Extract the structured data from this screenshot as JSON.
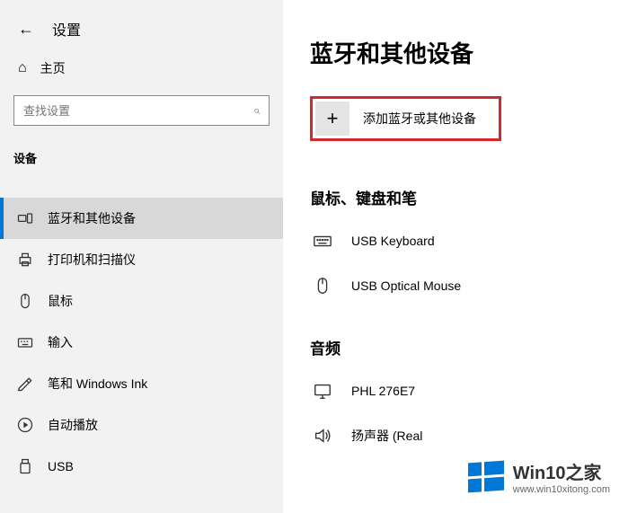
{
  "header": {
    "title": "设置"
  },
  "sidebar": {
    "home_label": "主页",
    "search_placeholder": "查找设置",
    "section_label": "设备",
    "items": [
      {
        "label": "蓝牙和其他设备"
      },
      {
        "label": "打印机和扫描仪"
      },
      {
        "label": "鼠标"
      },
      {
        "label": "输入"
      },
      {
        "label": "笔和 Windows Ink"
      },
      {
        "label": "自动播放"
      },
      {
        "label": "USB"
      }
    ]
  },
  "main": {
    "title": "蓝牙和其他设备",
    "add_device_label": "添加蓝牙或其他设备",
    "group1_title": "鼠标、键盘和笔",
    "devices1": [
      {
        "label": "USB Keyboard"
      },
      {
        "label": "USB Optical Mouse"
      }
    ],
    "group2_title": "音频",
    "devices2": [
      {
        "label": "PHL 276E7"
      },
      {
        "label": "扬声器 (Real"
      }
    ]
  },
  "watermark": {
    "title": "Win10之家",
    "url": "www.win10xitong.com"
  }
}
